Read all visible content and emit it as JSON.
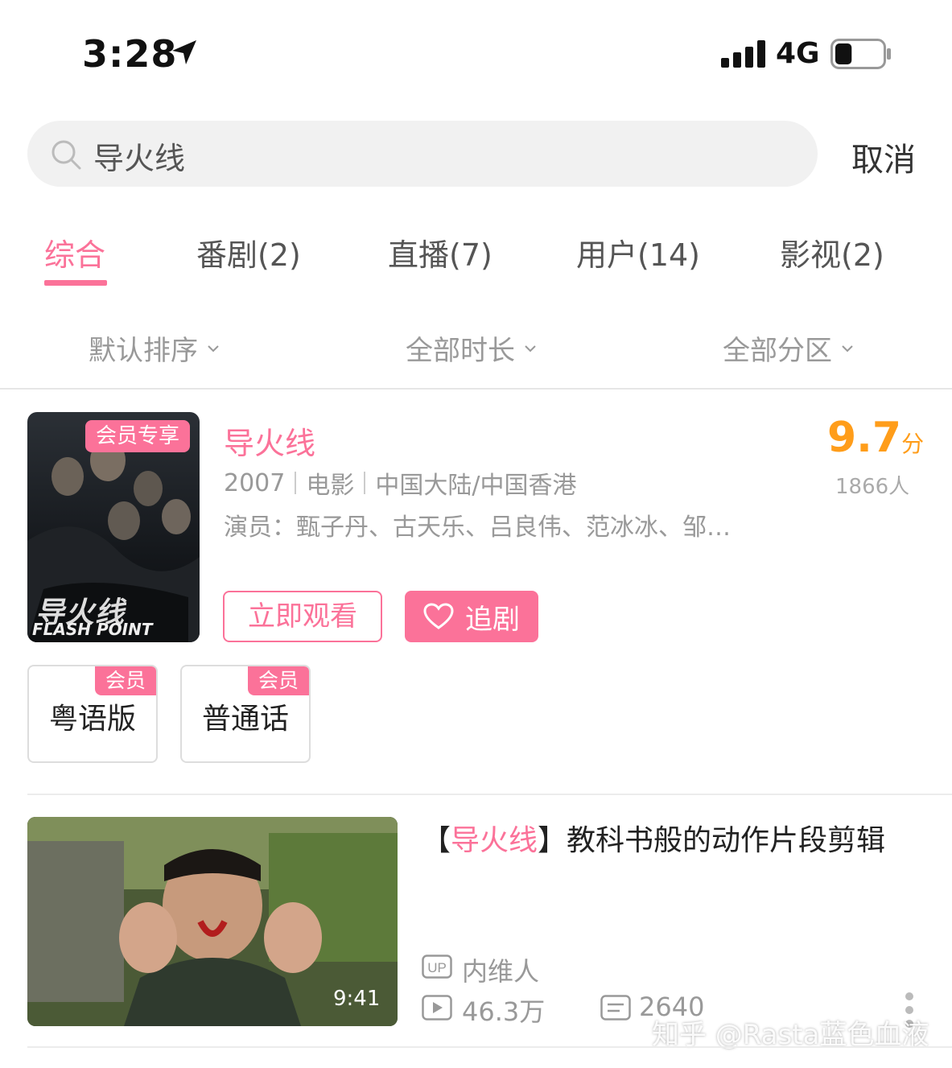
{
  "status_bar": {
    "time": "3:28",
    "network": "4G",
    "battery_level": 0.35
  },
  "search": {
    "query": "导火线",
    "cancel_label": "取消"
  },
  "tabs": [
    {
      "label": "综合",
      "active": true
    },
    {
      "label": "番剧(2)"
    },
    {
      "label": "直播(7)"
    },
    {
      "label": "用户(14)"
    },
    {
      "label": "影视(2)"
    }
  ],
  "filters": {
    "sort": "默认排序",
    "duration": "全部时长",
    "zone": "全部分区"
  },
  "movie": {
    "badge": "会员专享",
    "poster_title": "导火线",
    "poster_subtitle": "FLASH POINT",
    "title": "导火线",
    "year": "2007",
    "type": "电影",
    "region": "中国大陆/中国香港",
    "cast": "演员：甄子丹、古天乐、吕良伟、范冰冰、邹…",
    "score": "9.7",
    "score_unit": "分",
    "votes": "1866人",
    "watch_label": "立即观看",
    "follow_label": "追剧",
    "versions": [
      {
        "label": "粤语版",
        "tag": "会员"
      },
      {
        "label": "普通话",
        "tag": "会员"
      }
    ]
  },
  "video": {
    "title_prefix": "【",
    "title_highlight": "导火线",
    "title_rest": "】教科书般的动作片段剪辑",
    "duration": "9:41",
    "uploader": "内维人",
    "plays": "46.3万",
    "danmaku": "2640"
  },
  "watermark": "知乎 @Rasta蓝色血液",
  "colors": {
    "accent": "#fb7299",
    "score": "#ff9d1a"
  }
}
